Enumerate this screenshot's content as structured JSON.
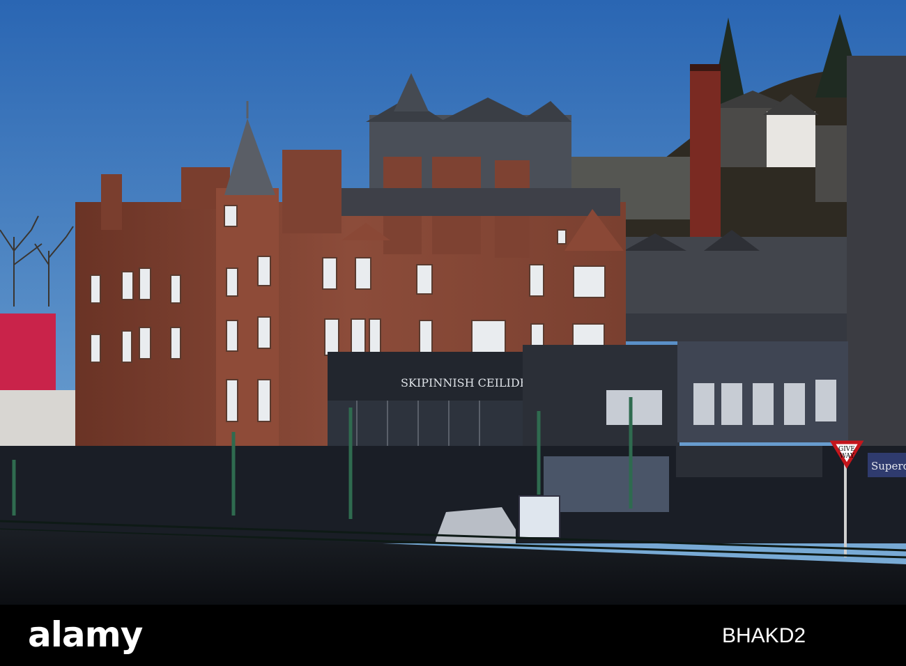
{
  "photo": {
    "subject": "Seafront street with red sandstone buildings under a blue sky",
    "signs": {
      "ceilidh_house": "SKIPINNISH CEILIDH HOUSE",
      "give_way_line1": "GIVE",
      "give_way_line2": "WAY",
      "shop_partial": "Superd"
    }
  },
  "watermark": {
    "brand": "alamy",
    "image_id": "BHAKD2"
  },
  "colors": {
    "sky_top": "#2f6fba",
    "sky_bottom": "#7eb0d8",
    "sandstone": "#8a4a38",
    "shadow": "#14181e",
    "footer": "#000000"
  }
}
